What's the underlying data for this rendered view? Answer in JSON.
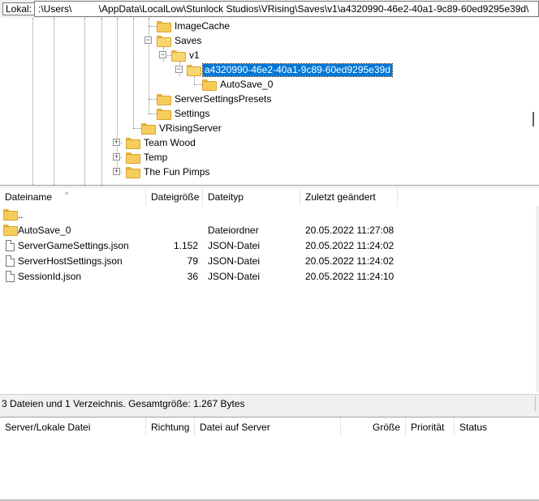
{
  "pathbar": {
    "label": "Lokal:",
    "path": ":\\Users\\          \\AppData\\LocalLow\\Stunlock Studios\\VRising\\Saves\\v1\\a4320990-46e2-40a1-9c89-60ed9295e39d\\"
  },
  "tree": {
    "nodes": [
      {
        "label": "ImageCache"
      },
      {
        "label": "Saves"
      },
      {
        "label": "v1"
      },
      {
        "label": "a4320990-46e2-40a1-9c89-60ed9295e39d"
      },
      {
        "label": "AutoSave_0"
      },
      {
        "label": "ServerSettingsPresets"
      },
      {
        "label": "Settings"
      },
      {
        "label": "VRisingServer"
      },
      {
        "label": "Team Wood"
      },
      {
        "label": "Temp"
      },
      {
        "label": "The Fun Pimps"
      }
    ],
    "expanded_symbol": "−",
    "collapsed_symbol": "+"
  },
  "filelist": {
    "columns": [
      "Dateiname",
      "Dateigröße",
      "Dateityp",
      "Zuletzt geändert"
    ],
    "sort_indicator": "^",
    "rows": [
      {
        "name": "..",
        "size": "",
        "type": "",
        "modified": "",
        "icon": "folder-icon"
      },
      {
        "name": "AutoSave_0",
        "size": "",
        "type": "Dateiordner",
        "modified": "20.05.2022 11:27:08",
        "icon": "folder-icon"
      },
      {
        "name": "ServerGameSettings.json",
        "size": "1.152",
        "type": "JSON-Datei",
        "modified": "20.05.2022 11:24:02",
        "icon": "file-icon"
      },
      {
        "name": "ServerHostSettings.json",
        "size": "79",
        "type": "JSON-Datei",
        "modified": "20.05.2022 11:24:02",
        "icon": "file-icon"
      },
      {
        "name": "SessionId.json",
        "size": "36",
        "type": "JSON-Datei",
        "modified": "20.05.2022 11:24:10",
        "icon": "file-icon"
      }
    ]
  },
  "status": {
    "text": "3 Dateien und 1 Verzeichnis. Gesamtgröße: 1.267 Bytes"
  },
  "queue": {
    "columns": [
      "Server/Lokale Datei",
      "Richtung",
      "Datei auf Server",
      "Größe",
      "Priorität",
      "Status"
    ]
  },
  "colors": {
    "selection": "#0078d7",
    "folder": "#f6cc5a"
  }
}
